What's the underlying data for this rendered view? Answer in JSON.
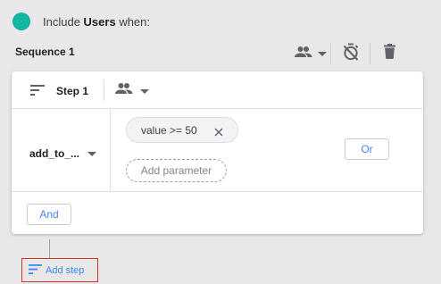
{
  "header": {
    "prefix": "Include",
    "entity": "Users",
    "suffix": "when:",
    "dot_color": "#12b5a0"
  },
  "sequence": {
    "title": "Sequence 1",
    "tools": [
      "people-icon",
      "stopwatch-off-icon",
      "trash-icon"
    ]
  },
  "step": {
    "label": "Step 1",
    "event": "add_to_...",
    "condition_chip": "value >= 50",
    "add_parameter": "Add parameter",
    "or_label": "Or",
    "and_label": "And"
  },
  "footer": {
    "add_step": "Add step"
  },
  "colors": {
    "accent": "#4285f4",
    "highlight_border": "#d93025"
  }
}
